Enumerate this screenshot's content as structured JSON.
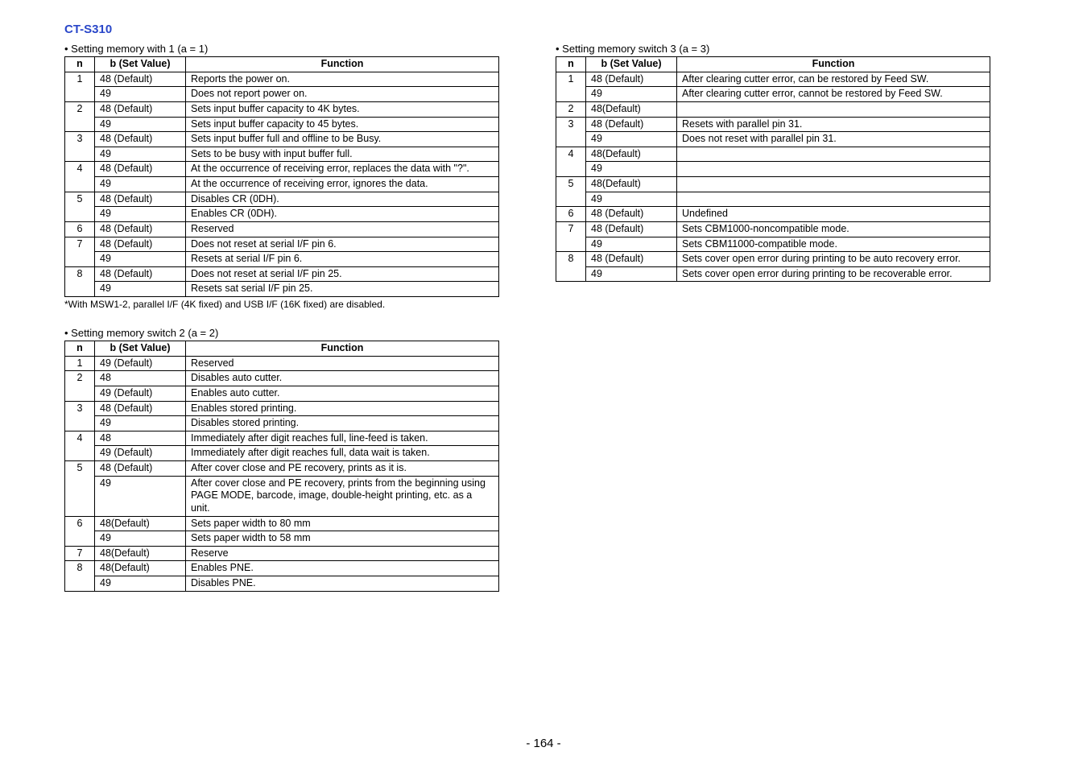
{
  "title": "CT-S310",
  "page_number": "- 164 -",
  "tables": [
    {
      "caption": "• Setting memory with 1 (a = 1)",
      "footnote": "*With MSW1-2, parallel I/F (4K fixed) and USB I/F (16K fixed) are disabled.",
      "headers": [
        "n",
        "b (Set Value)",
        "Function"
      ],
      "rows": [
        {
          "n": "1",
          "b": "48 (Default)",
          "f": "Reports the power on."
        },
        {
          "n": "",
          "b": "49",
          "f": "Does not report power on."
        },
        {
          "n": "2",
          "b": "48 (Default)",
          "f": "Sets input buffer capacity to 4K bytes."
        },
        {
          "n": "",
          "b": "49",
          "f": "Sets input buffer capacity to 45 bytes."
        },
        {
          "n": "3",
          "b": "48 (Default)",
          "f": "Sets input buffer full and offline to be Busy."
        },
        {
          "n": "",
          "b": "49",
          "f": "Sets to be busy with input buffer full."
        },
        {
          "n": "4",
          "b": "48 (Default)",
          "f": "At the occurrence of receiving error, replaces the data with \"?\"."
        },
        {
          "n": "",
          "b": "49",
          "f": "At the occurrence of receiving error, ignores the data."
        },
        {
          "n": "5",
          "b": "48 (Default)",
          "f": "Disables CR (0DH)."
        },
        {
          "n": "",
          "b": "49",
          "f": "Enables CR (0DH)."
        },
        {
          "n": "6",
          "b": "48 (Default)",
          "f": "Reserved"
        },
        {
          "n": "7",
          "b": "48 (Default)",
          "f": "Does not reset at serial I/F pin 6."
        },
        {
          "n": "",
          "b": "49",
          "f": "Resets at serial I/F pin 6."
        },
        {
          "n": "8",
          "b": "48 (Default)",
          "f": "Does not reset at serial I/F pin 25."
        },
        {
          "n": "",
          "b": "49",
          "f": "Resets sat serial I/F pin 25."
        }
      ],
      "spans": {
        "0": 2,
        "2": 2,
        "4": 2,
        "6": 2,
        "8": 2,
        "10": 1,
        "11": 2,
        "13": 2
      }
    },
    {
      "caption": "• Setting memory switch 2 (a = 2)",
      "headers": [
        "n",
        "b (Set Value)",
        "Function"
      ],
      "rows": [
        {
          "n": "1",
          "b": "49 (Default)",
          "f": "Reserved"
        },
        {
          "n": "2",
          "b": "48",
          "f": "Disables auto cutter."
        },
        {
          "n": "",
          "b": "49 (Default)",
          "f": "Enables auto cutter."
        },
        {
          "n": "3",
          "b": "48 (Default)",
          "f": "Enables stored printing."
        },
        {
          "n": "",
          "b": "49",
          "f": "Disables stored printing."
        },
        {
          "n": "4",
          "b": "48",
          "f": "Immediately after digit reaches full, line-feed is taken."
        },
        {
          "n": "",
          "b": "49 (Default)",
          "f": "Immediately after digit reaches full, data wait is taken."
        },
        {
          "n": "5",
          "b": "48 (Default)",
          "f": "After cover close and PE recovery, prints as it is."
        },
        {
          "n": "",
          "b": "49",
          "f": "After cover close and PE recovery, prints from the beginning using PAGE MODE, barcode, image, double-height printing, etc. as a unit."
        },
        {
          "n": "6",
          "b": "48(Default)",
          "f": "Sets paper width to 80 mm"
        },
        {
          "n": "",
          "b": "49",
          "f": "Sets paper width to 58 mm"
        },
        {
          "n": "7",
          "b": "48(Default)",
          "f": "Reserve"
        },
        {
          "n": "8",
          "b": "48(Default)",
          "f": "Enables PNE."
        },
        {
          "n": "",
          "b": "49",
          "f": "Disables PNE."
        }
      ],
      "spans": {
        "0": 1,
        "1": 2,
        "3": 2,
        "5": 2,
        "7": 2,
        "9": 1,
        "10": 1,
        "11": 1,
        "12": 2
      },
      "spans_extra": {
        "9": true
      }
    },
    {
      "caption": "• Setting memory switch 3 (a = 3)",
      "headers": [
        "n",
        "b (Set Value)",
        "Function"
      ],
      "rows": [
        {
          "n": "1",
          "b": "48 (Default)",
          "f": "After clearing cutter error, can be restored by Feed SW."
        },
        {
          "n": "",
          "b": "49",
          "f": "After clearing cutter error, cannot be restored by Feed SW."
        },
        {
          "n": "2",
          "b": "48(Default)",
          "f": ""
        },
        {
          "n": "3",
          "b": "48 (Default)",
          "f": "Resets with parallel pin 31."
        },
        {
          "n": "",
          "b": "49",
          "f": "Does not reset with parallel pin 31."
        },
        {
          "n": "4",
          "b": "48(Default)",
          "f": ""
        },
        {
          "n": "",
          "b": "49",
          "f": ""
        },
        {
          "n": "5",
          "b": "48(Default)",
          "f": ""
        },
        {
          "n": "",
          "b": "49",
          "f": ""
        },
        {
          "n": "6",
          "b": "48 (Default)",
          "f": "Undefined"
        },
        {
          "n": "7",
          "b": "48 (Default)",
          "f": "Sets CBM1000-noncompatible mode."
        },
        {
          "n": "",
          "b": "49",
          "f": "Sets CBM11000-compatible mode."
        },
        {
          "n": "8",
          "b": "48 (Default)",
          "f": "Sets cover open error during printing to be auto recovery error."
        },
        {
          "n": "",
          "b": "49",
          "f": "Sets cover open error during printing to be recoverable error."
        }
      ],
      "spans": {
        "0": 2,
        "2": 1,
        "3": 2,
        "5": 2,
        "7": 2,
        "9": 1,
        "10": 1,
        "11": 1,
        "12": 2
      },
      "spans_extra": {
        "10": true
      }
    }
  ]
}
